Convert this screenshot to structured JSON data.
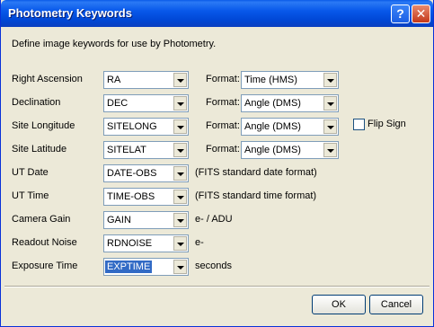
{
  "window": {
    "title": "Photometry Keywords",
    "help_glyph": "?",
    "close_glyph": "✕"
  },
  "intro": "Define image keywords for use by Photometry.",
  "format_label": "Format:",
  "rows": [
    {
      "label": "Right Ascension",
      "keyword": "RA",
      "format": "Time (HMS)"
    },
    {
      "label": "Declination",
      "keyword": "DEC",
      "format": "Angle (DMS)"
    },
    {
      "label": "Site Longitude",
      "keyword": "SITELONG",
      "format": "Angle (DMS)"
    },
    {
      "label": "Site Latitude",
      "keyword": "SITELAT",
      "format": "Angle (DMS)"
    },
    {
      "label": "UT Date",
      "keyword": "DATE-OBS",
      "note": "(FITS standard date format)"
    },
    {
      "label": "UT Time",
      "keyword": "TIME-OBS",
      "note": "(FITS standard time format)"
    },
    {
      "label": "Camera Gain",
      "keyword": "GAIN",
      "note": "e- / ADU"
    },
    {
      "label": "Readout Noise",
      "keyword": "RDNOISE",
      "note": "e-"
    },
    {
      "label": "Exposure Time",
      "keyword": "EXPTIME",
      "note": "seconds"
    }
  ],
  "flip_sign": {
    "label": "Flip Sign",
    "checked": false
  },
  "buttons": {
    "ok": "OK",
    "cancel": "Cancel"
  }
}
